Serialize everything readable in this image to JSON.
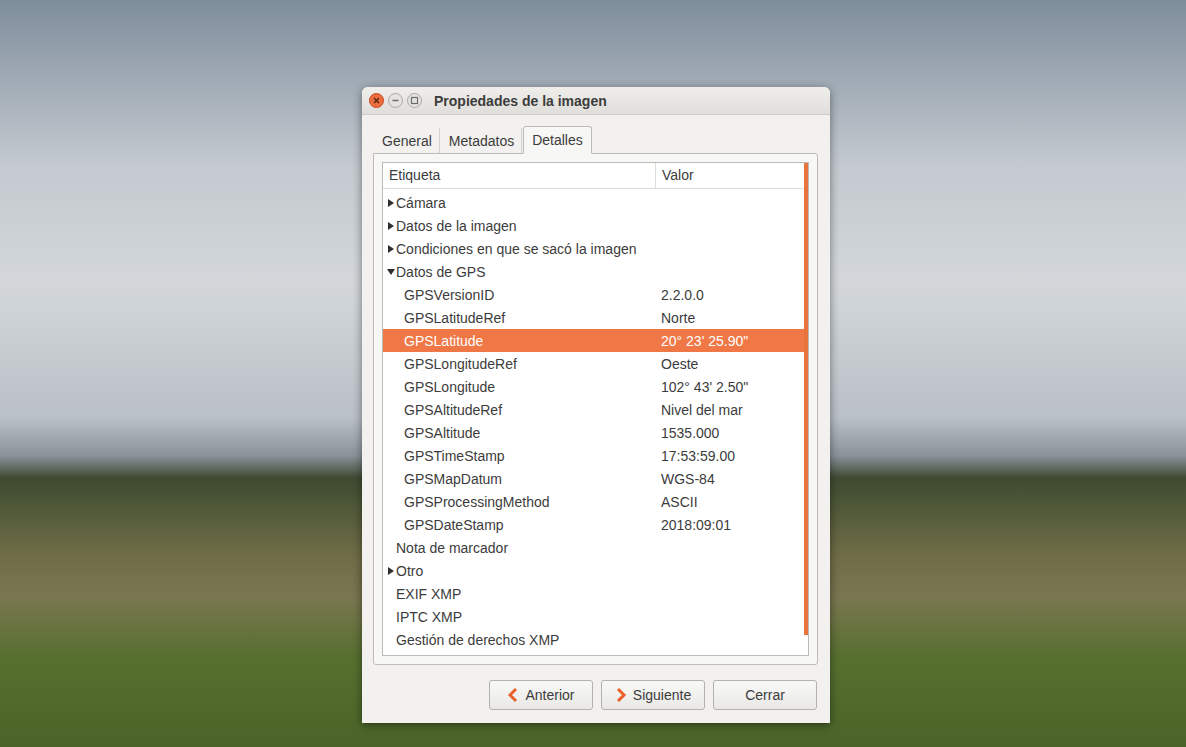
{
  "window": {
    "title": "Propiedades de la imagen"
  },
  "tabs": [
    {
      "label": "General",
      "selected": false
    },
    {
      "label": "Metadatos",
      "selected": false
    },
    {
      "label": "Detalles",
      "selected": true
    }
  ],
  "tree": {
    "columns": [
      "Etiqueta",
      "Valor"
    ],
    "groups": [
      {
        "label": "Cámara",
        "expandable": true,
        "expanded": false,
        "selected": false,
        "children": []
      },
      {
        "label": "Datos de la imagen",
        "expandable": true,
        "expanded": false,
        "selected": false,
        "children": []
      },
      {
        "label": "Condiciones en que se sacó la imagen",
        "expandable": true,
        "expanded": false,
        "selected": false,
        "children": []
      },
      {
        "label": "Datos de GPS",
        "expandable": true,
        "expanded": true,
        "selected": false,
        "children": [
          {
            "label": "GPSVersionID",
            "value": "2.2.0.0",
            "selected": false
          },
          {
            "label": "GPSLatitudeRef",
            "value": "Norte",
            "selected": false
          },
          {
            "label": "GPSLatitude",
            "value": "20° 23' 25.90\"",
            "selected": true
          },
          {
            "label": "GPSLongitudeRef",
            "value": "Oeste",
            "selected": false
          },
          {
            "label": "GPSLongitude",
            "value": "102° 43' 2.50\"",
            "selected": false
          },
          {
            "label": "GPSAltitudeRef",
            "value": "Nivel del mar",
            "selected": false
          },
          {
            "label": "GPSAltitude",
            "value": "1535.000",
            "selected": false
          },
          {
            "label": "GPSTimeStamp",
            "value": "17:53:59.00",
            "selected": false
          },
          {
            "label": "GPSMapDatum",
            "value": "WGS-84",
            "selected": false
          },
          {
            "label": "GPSProcessingMethod",
            "value": "ASCII",
            "selected": false
          },
          {
            "label": "GPSDateStamp",
            "value": "2018:09:01",
            "selected": false
          }
        ]
      },
      {
        "label": "Nota de marcador",
        "expandable": false,
        "expanded": false,
        "selected": false,
        "children": []
      },
      {
        "label": "Otro",
        "expandable": true,
        "expanded": false,
        "selected": false,
        "children": []
      },
      {
        "label": "EXIF XMP",
        "expandable": false,
        "expanded": false,
        "selected": false,
        "children": []
      },
      {
        "label": "IPTC XMP",
        "expandable": false,
        "expanded": false,
        "selected": false,
        "children": []
      },
      {
        "label": "Gestión de derechos XMP",
        "expandable": false,
        "expanded": false,
        "selected": false,
        "children": []
      }
    ],
    "scrollbar": {
      "level": 0.96
    }
  },
  "buttons": [
    {
      "label": "Anterior",
      "kind": "previous"
    },
    {
      "label": "Siguiente",
      "kind": "next"
    },
    {
      "label": "Cerrar",
      "kind": "plain"
    }
  ]
}
